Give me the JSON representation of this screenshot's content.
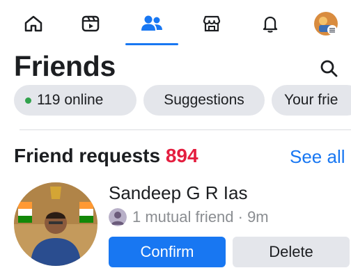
{
  "nav": {
    "icons": [
      "home-icon",
      "video-icon",
      "friends-icon",
      "marketplace-icon",
      "notifications-icon",
      "profile-avatar"
    ],
    "active": "friends-icon"
  },
  "page": {
    "title": "Friends",
    "search_icon": "search-icon"
  },
  "pills": {
    "online_count": "119 online",
    "suggestions": "Suggestions",
    "your_friends": "Your frie"
  },
  "requests": {
    "title": "Friend requests",
    "count": "894",
    "see_all": "See all",
    "item": {
      "name": "Sandeep G R Ias",
      "mutual": "1 mutual friend · 9m",
      "confirm": "Confirm",
      "delete": "Delete"
    }
  },
  "colors": {
    "accent": "#1877f2",
    "count": "#e41e3f",
    "online": "#31a24c",
    "pill_bg": "#e4e6eb"
  }
}
